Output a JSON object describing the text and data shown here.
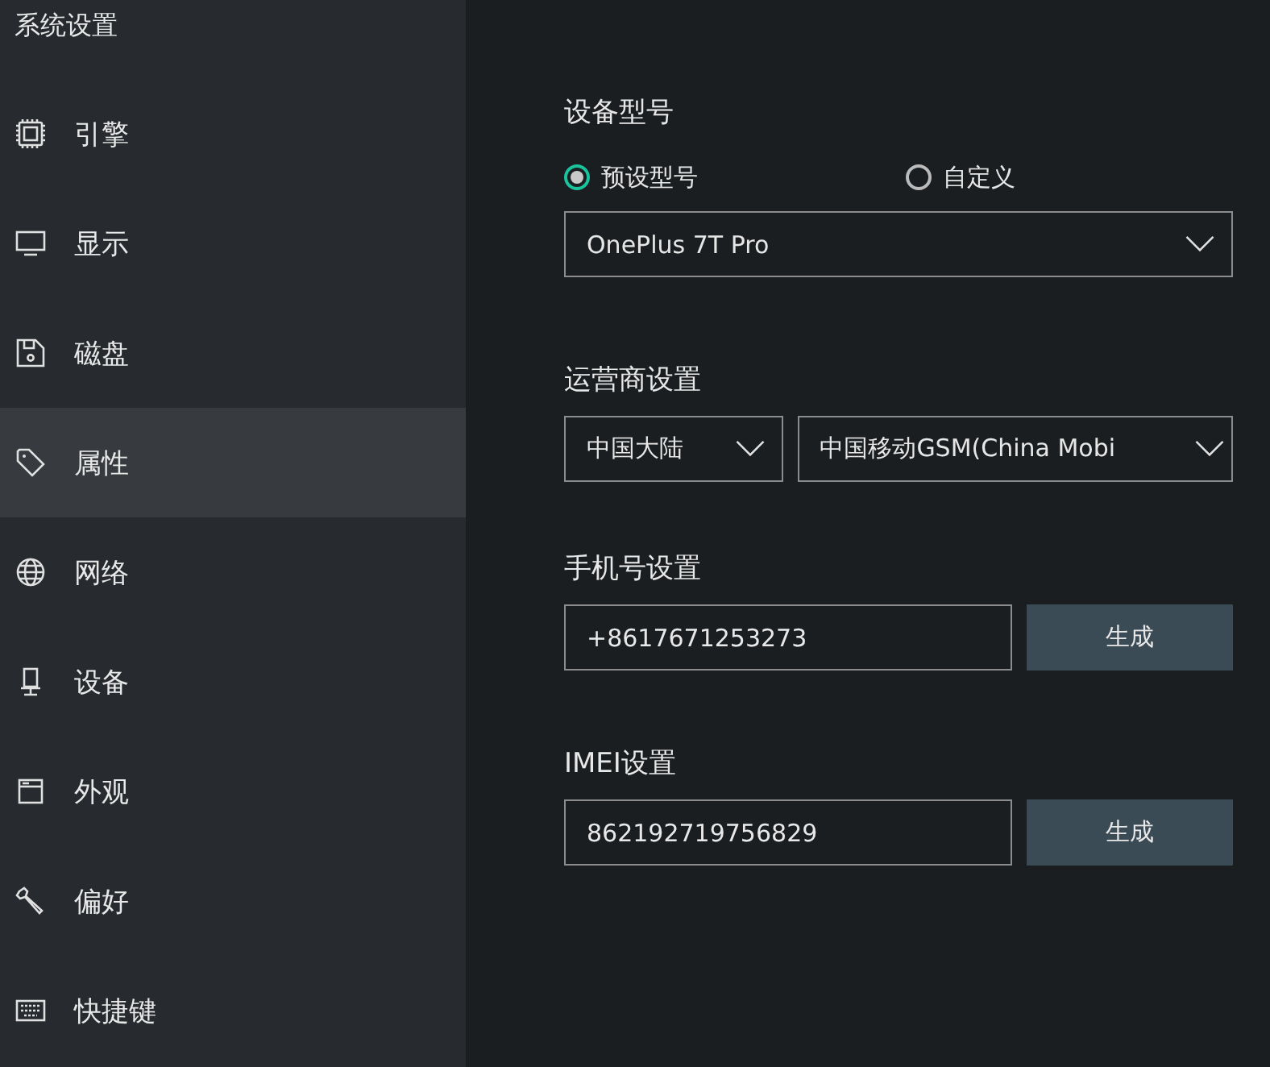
{
  "sidebar": {
    "title": "系统设置",
    "items": [
      {
        "label": "引擎",
        "selected": false
      },
      {
        "label": "显示",
        "selected": false
      },
      {
        "label": "磁盘",
        "selected": false
      },
      {
        "label": "属性",
        "selected": true
      },
      {
        "label": "网络",
        "selected": false
      },
      {
        "label": "设备",
        "selected": false
      },
      {
        "label": "外观",
        "selected": false
      },
      {
        "label": "偏好",
        "selected": false
      },
      {
        "label": "快捷键",
        "selected": false
      }
    ]
  },
  "device_model": {
    "title": "设备型号",
    "options": [
      {
        "label": "预设型号",
        "selected": true
      },
      {
        "label": "自定义",
        "selected": false
      }
    ],
    "model": "OnePlus 7T Pro"
  },
  "carrier": {
    "title": "运营商设置",
    "region": "中国大陆",
    "operator": "中国移动GSM(China Mobi"
  },
  "phone": {
    "title": "手机号设置",
    "value": "+8617671253273",
    "button": "生成"
  },
  "imei": {
    "title": "IMEI设置",
    "value": "862192719756829",
    "button": "生成"
  }
}
